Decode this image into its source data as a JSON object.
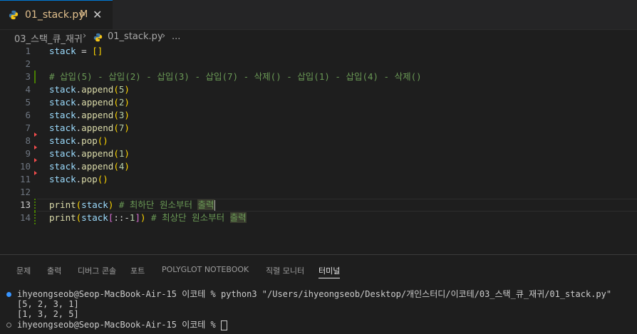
{
  "tab": {
    "title": "01_stack.py",
    "modified_marker": "M",
    "close_glyph": "✕",
    "icon": "python-icon",
    "title_color": "#e2c08d"
  },
  "breadcrumb": {
    "folder": "03_스택_큐_재귀",
    "file": "01_stack.py",
    "more": "...",
    "separator": "›"
  },
  "editor": {
    "lines": [
      {
        "num": "1",
        "tokens": [
          [
            "v",
            "stack"
          ],
          [
            "p",
            " = "
          ],
          [
            "b1",
            "[]"
          ]
        ]
      },
      {
        "num": "2",
        "tokens": []
      },
      {
        "num": "3",
        "tokens": [
          [
            "c",
            "# 삽입(5) - 삽입(2) - 삽입(3) - 삽입(7) - 삭제() - 삽입(1) - 삽입(4) - 삭제()"
          ]
        ]
      },
      {
        "num": "4",
        "tokens": [
          [
            "v",
            "stack"
          ],
          [
            "p",
            "."
          ],
          [
            "f",
            "append"
          ],
          [
            "b1",
            "("
          ],
          [
            "n",
            "5"
          ],
          [
            "b1",
            ")"
          ]
        ]
      },
      {
        "num": "5",
        "tokens": [
          [
            "v",
            "stack"
          ],
          [
            "p",
            "."
          ],
          [
            "f",
            "append"
          ],
          [
            "b1",
            "("
          ],
          [
            "n",
            "2"
          ],
          [
            "b1",
            ")"
          ]
        ]
      },
      {
        "num": "6",
        "tokens": [
          [
            "v",
            "stack"
          ],
          [
            "p",
            "."
          ],
          [
            "f",
            "append"
          ],
          [
            "b1",
            "("
          ],
          [
            "n",
            "3"
          ],
          [
            "b1",
            ")"
          ]
        ]
      },
      {
        "num": "7",
        "tokens": [
          [
            "v",
            "stack"
          ],
          [
            "p",
            "."
          ],
          [
            "f",
            "append"
          ],
          [
            "b1",
            "("
          ],
          [
            "n",
            "7"
          ],
          [
            "b1",
            ")"
          ]
        ]
      },
      {
        "num": "8",
        "tokens": [
          [
            "v",
            "stack"
          ],
          [
            "p",
            "."
          ],
          [
            "f",
            "pop"
          ],
          [
            "b1",
            "()"
          ]
        ]
      },
      {
        "num": "9",
        "tokens": [
          [
            "v",
            "stack"
          ],
          [
            "p",
            "."
          ],
          [
            "f",
            "append"
          ],
          [
            "b1",
            "("
          ],
          [
            "n",
            "1"
          ],
          [
            "b1",
            ")"
          ]
        ]
      },
      {
        "num": "10",
        "tokens": [
          [
            "v",
            "stack"
          ],
          [
            "p",
            "."
          ],
          [
            "f",
            "append"
          ],
          [
            "b1",
            "("
          ],
          [
            "n",
            "4"
          ],
          [
            "b1",
            ")"
          ]
        ]
      },
      {
        "num": "11",
        "tokens": [
          [
            "v",
            "stack"
          ],
          [
            "p",
            "."
          ],
          [
            "f",
            "pop"
          ],
          [
            "b1",
            "()"
          ]
        ]
      },
      {
        "num": "12",
        "tokens": []
      },
      {
        "num": "13",
        "tokens": [
          [
            "f",
            "print"
          ],
          [
            "b1",
            "("
          ],
          [
            "v",
            "stack"
          ],
          [
            "b1",
            ")"
          ],
          [
            "c",
            " # 최하단 원소부터 "
          ],
          [
            "chl",
            "출력"
          ]
        ]
      },
      {
        "num": "14",
        "tokens": [
          [
            "f",
            "print"
          ],
          [
            "b1",
            "("
          ],
          [
            "v",
            "stack"
          ],
          [
            "b2",
            "["
          ],
          [
            "p",
            "::-"
          ],
          [
            "n",
            "1"
          ],
          [
            "b2",
            "]"
          ],
          [
            "b1",
            ")"
          ],
          [
            "c",
            " # 최상단 원소부터 "
          ],
          [
            "chl",
            "출력"
          ]
        ]
      }
    ],
    "active_line": "13"
  },
  "panel": {
    "tabs": [
      "문제",
      "출력",
      "디버그 콘솔",
      "포트",
      "POLYGLOT NOTEBOOK",
      "직렬 모니터",
      "터미널"
    ],
    "active_tab": "터미널"
  },
  "terminal": {
    "lines": [
      {
        "prompt": "ihyeongseob@Seop-MacBook-Air-15 이코테 % ",
        "command": "python3 \"/Users/ihyeongseob/Desktop/개인스터디/이코테/03_스택_큐_재귀/01_stack.py\"",
        "dot": "#3794ff"
      },
      {
        "output": "[5, 2, 3, 1]"
      },
      {
        "output": "[1, 3, 2, 5]"
      },
      {
        "prompt": "ihyeongseob@Seop-MacBook-Air-15 이코테 % ",
        "dot": "#8b8b8b"
      }
    ]
  },
  "colors": {
    "background": "#1e1e1e",
    "accent": "#0078d4",
    "gutter_added": "#487e02",
    "gutter_deleted": "#f14c4c"
  }
}
